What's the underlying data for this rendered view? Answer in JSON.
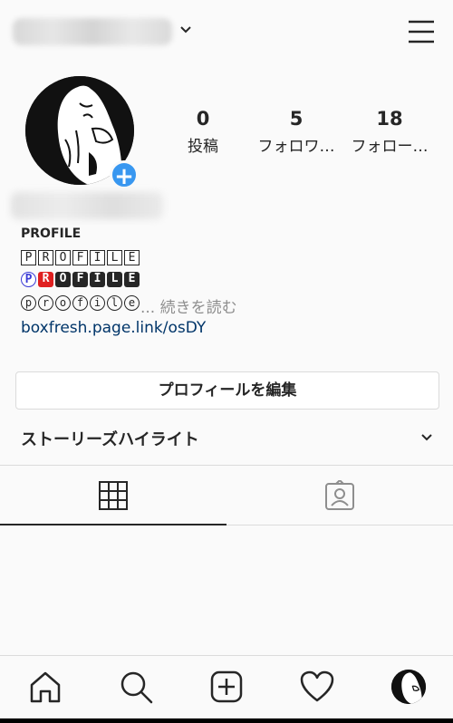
{
  "header": {
    "username_visible": "",
    "icons": [
      "chevron-down-icon",
      "hamburger-menu-icon"
    ]
  },
  "profile": {
    "stats": [
      {
        "value": "0",
        "label": "投稿"
      },
      {
        "value": "5",
        "label": "フォロワ…"
      },
      {
        "value": "18",
        "label": "フォロー…"
      }
    ],
    "bio_heading": "PROFILE",
    "bio_line1": [
      "P",
      "R",
      "O",
      "F",
      "I",
      "L",
      "E"
    ],
    "bio_line2": [
      "P",
      "R",
      "O",
      "F",
      "I",
      "L",
      "E"
    ],
    "bio_line3": [
      "p",
      "r",
      "o",
      "f",
      "i",
      "l",
      "e"
    ],
    "more_label": "... 続きを読む",
    "link": "boxfresh.page.link/osDY",
    "edit_button": "プロフィールを編集",
    "highlights_title": "ストーリーズハイライト"
  },
  "colors": {
    "accent": "#3897f0",
    "link": "#003569",
    "text": "#262626",
    "muted": "#8e8e8e",
    "border": "#dbdbdb"
  },
  "tabs": [
    "grid-icon",
    "tagged-icon"
  ],
  "bottom_nav": [
    "home-icon",
    "search-icon",
    "new-post-icon",
    "heart-icon",
    "profile-avatar"
  ]
}
